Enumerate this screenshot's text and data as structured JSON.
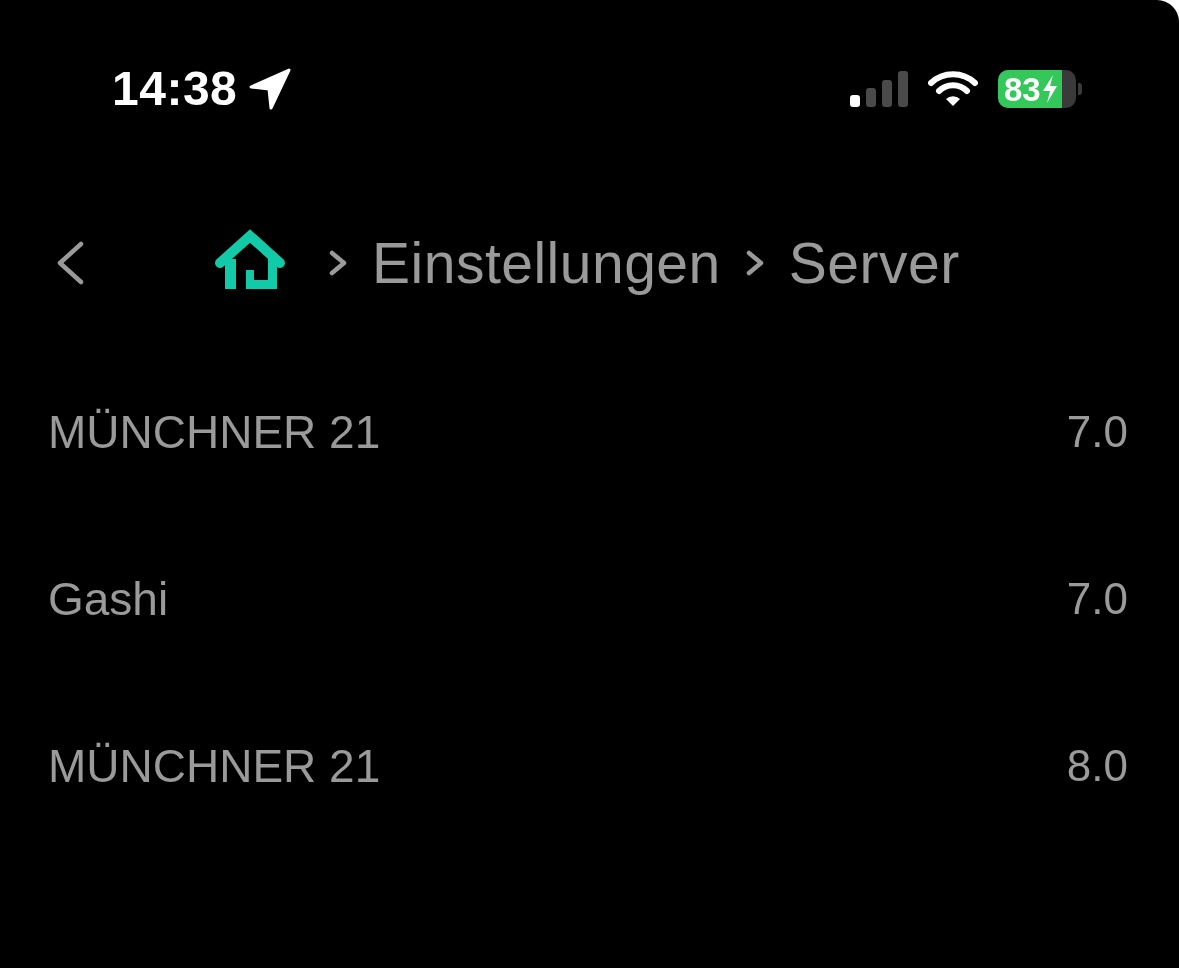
{
  "status_bar": {
    "time": "14:38",
    "battery_percentage": "83"
  },
  "breadcrumb": {
    "items": [
      {
        "label": "Einstellungen"
      },
      {
        "label": "Server"
      }
    ]
  },
  "servers": [
    {
      "name": "MÜNCHNER 21",
      "version": "7.0"
    },
    {
      "name": "Gashi",
      "version": "7.0"
    },
    {
      "name": "MÜNCHNER 21",
      "version": "8.0"
    }
  ]
}
